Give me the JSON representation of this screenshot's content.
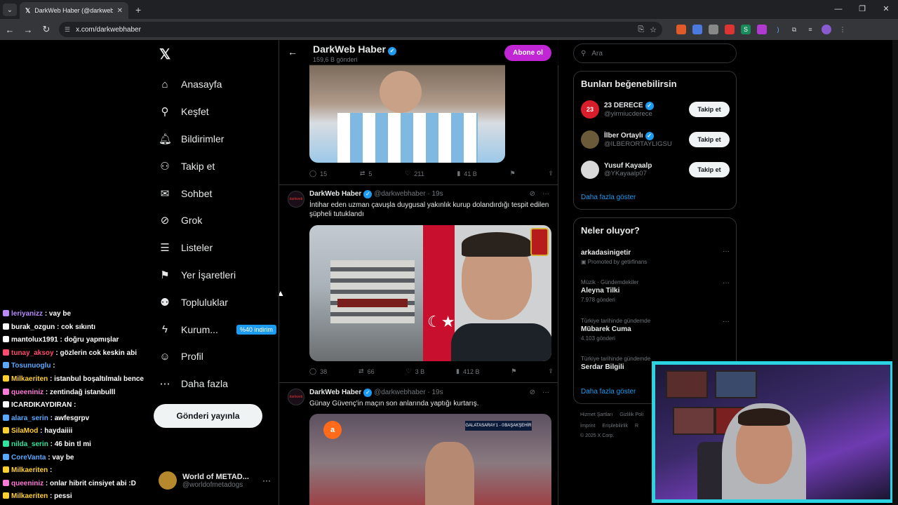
{
  "browser": {
    "tab_title": "DarkWeb Haber (@darkwebhaber) / X",
    "url": "x.com/darkwebhaber"
  },
  "nav": {
    "items": [
      {
        "label": "Anasayfa",
        "icon": "home-icon"
      },
      {
        "label": "Keşfet",
        "icon": "search-icon"
      },
      {
        "label": "Bildirimler",
        "icon": "bell-icon"
      },
      {
        "label": "Takip et",
        "icon": "person-plus-icon"
      },
      {
        "label": "Sohbet",
        "icon": "mail-icon"
      },
      {
        "label": "Grok",
        "icon": "grok-icon"
      },
      {
        "label": "Listeler",
        "icon": "list-icon"
      },
      {
        "label": "Yer İşaretleri",
        "icon": "bookmark-icon"
      },
      {
        "label": "Topluluklar",
        "icon": "people-icon"
      },
      {
        "label": "Kurum...",
        "icon": "lightning-icon"
      },
      {
        "label": "Profil",
        "icon": "profile-icon"
      },
      {
        "label": "Daha fazla",
        "icon": "more-circle-icon"
      }
    ],
    "promo_badge": "%40 indirim",
    "post_button": "Gönderi yayınla",
    "account_name": "World of METAD...",
    "account_handle": "@worldofmetadogs"
  },
  "chat": [
    {
      "user": "leriyanizz",
      "msg": ": vay be",
      "color": "#b98bff"
    },
    {
      "user": "burak_ozgun",
      "msg": ": cok sıkıntı",
      "color": "#ffffff"
    },
    {
      "user": "mantolux1991",
      "msg": ": doğru yapmışlar",
      "color": "#ffffff"
    },
    {
      "user": "tunay_aksoy",
      "msg": ": gözlerin cok keskin abi",
      "color": "#ff4b6e"
    },
    {
      "user": "Tosunuoglu",
      "msg": ":",
      "color": "#5aa9ff"
    },
    {
      "user": "Milkaeriten",
      "msg": ": istanbul boşaltılmalı bence",
      "color": "#ffd02e"
    },
    {
      "user": "queeniniz",
      "msg": ": zentindağ istanbulll",
      "color": "#ff7ad9"
    },
    {
      "user": "ICARDIKAYDIRAN",
      "msg": ":",
      "color": "#ffffff"
    },
    {
      "user": "alara_serin",
      "msg": ": awfesgrpv",
      "color": "#5aa9ff"
    },
    {
      "user": "SilaMod",
      "msg": ": haydaiiii",
      "color": "#ffd02e"
    },
    {
      "user": "nilda_serin",
      "msg": ": 46 bin tl mi",
      "color": "#2ee6a0"
    },
    {
      "user": "CoreVanta",
      "msg": ": vay be",
      "color": "#5aa9ff"
    },
    {
      "user": "Milkaeriten",
      "msg": ":",
      "color": "#ffd02e"
    },
    {
      "user": "queeniniz",
      "msg": ": onlar hibrit cinsiyet abi :D",
      "color": "#ff7ad9"
    },
    {
      "user": "Milkaeriten",
      "msg": ": pessi",
      "color": "#ffd02e"
    }
  ],
  "profile": {
    "name": "DarkWeb Haber",
    "post_count": "159,6 B gönderi",
    "subscribe": "Abone ol"
  },
  "tweets": [
    {
      "replies": "15",
      "retweets": "5",
      "likes": "211",
      "views": "41 B"
    },
    {
      "name": "DarkWeb Haber",
      "handle": "@darkwebhaber",
      "time": "· 19s",
      "text": "İntihar eden uzman çavuşla duygusal yakınlık kurup dolandırdığı tespit edilen şüpheli tutuklandı",
      "replies": "38",
      "retweets": "66",
      "likes": "3 B",
      "views": "412 B"
    },
    {
      "name": "DarkWeb Haber",
      "handle": "@darkwebhaber",
      "time": "· 19s",
      "text": "Günay Güvenç'in maçın son anlarında yaptığı kurtarış."
    }
  ],
  "sidebar": {
    "search_placeholder": "Ara",
    "suggest_title": "Bunları beğenebilirsin",
    "suggestions": [
      {
        "name": "23 DERECE",
        "handle": "@yirmiucderece",
        "avatar_text": "23",
        "color": "#d81e2a"
      },
      {
        "name": "İlber Ortaylı",
        "handle": "@ILBERORTAYLIGSU",
        "avatar_text": "",
        "color": "#6b5a3a"
      },
      {
        "name": "Yusuf Kayaalp",
        "handle": "@YKayaalp07",
        "avatar_text": "",
        "color": "#d9d9d9"
      }
    ],
    "follow_label": "Takip et",
    "show_more": "Daha fazla göster",
    "trends_title": "Neler oluyor?",
    "trends": [
      {
        "meta": "",
        "topic": "arkadasinigetir",
        "sub": "Promoted by getirfinans"
      },
      {
        "meta": "Müzik · Gündemdekiler",
        "topic": "Aleyna Tilki",
        "sub": "7.978 gönderi"
      },
      {
        "meta": "Türkiye tarihinde gündemde",
        "topic": "Mübarek Cuma",
        "sub": "4.103 gönderi"
      },
      {
        "meta": "Türkiye tarihinde gündemde",
        "topic": "Serdar Bilgili",
        "sub": ""
      }
    ],
    "footer": [
      "Hizmet Şartları",
      "Gizlilik Poli",
      "İmprint",
      "Erişilebilirlik",
      "R"
    ],
    "copyright": "© 2025 X Corp."
  },
  "match_overlay": {
    "home": "GALATASARAY",
    "score": "1 - 0",
    "away": "BAŞAKŞEHİR"
  }
}
